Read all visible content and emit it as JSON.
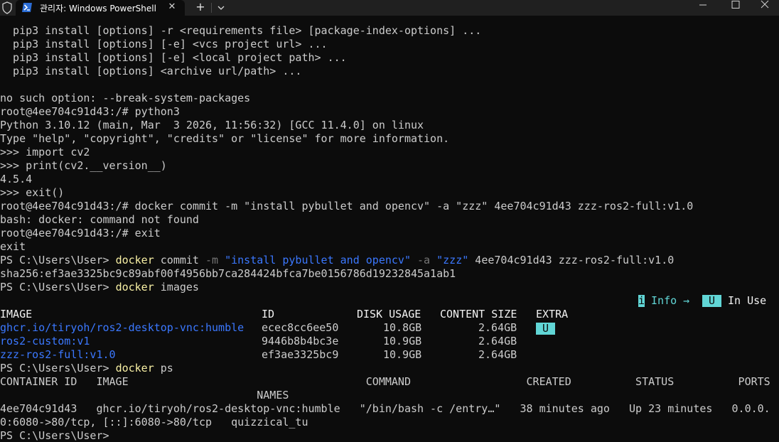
{
  "window": {
    "tab_title": "관리자: Windows PowerShell",
    "tab_close": "✕",
    "new_tab": "+"
  },
  "colors": {
    "background": "#0c0c0c",
    "titlebar": "#202020",
    "text": "#cccccc",
    "command_yellow": "#f9f1a5",
    "link_blue": "#3b78ff",
    "badge_cyan": "#61d6d6"
  },
  "icons": {
    "shield": "shield-icon",
    "powershell": "powershell-icon",
    "dropdown": "chevron-down-icon",
    "minimize": "minimize-icon",
    "maximize": "maximize-icon",
    "close": "close-icon"
  },
  "terminal": {
    "lines": [
      "  pip3 install [options] -r <requirements file> [package-index-options] ...",
      "  pip3 install [options] [-e] <vcs project url> ...",
      "  pip3 install [options] [-e] <local project path> ...",
      "  pip3 install [options] <archive url/path> ...",
      "",
      "no such option: --break-system-packages",
      "root@4ee704c91d43:/# python3",
      "Python 3.10.12 (main, Mar  3 2026, 11:56:32) [GCC 11.4.0] on linux",
      "Type \"help\", \"copyright\", \"credits\" or \"license\" for more information.",
      ">>> import cv2",
      ">>> print(cv2.__version__)",
      "4.5.4",
      ">>> exit()",
      "root@4ee704c91d43:/# docker commit -m \"install pybullet and opencv\" -a \"zzz\" 4ee704c91d43 zzz-ros2-full:v1.0",
      "bash: docker: command not found",
      "root@4ee704c91d43:/# exit",
      "exit"
    ],
    "ps_commit": {
      "prompt": "PS C:\\Users\\User> ",
      "cmd": "docker",
      "sub": " commit ",
      "flag_m": "-m",
      "msg": " \"install pybullet and opencv\"",
      "flag_a": " -a",
      "author": " \"zzz\"",
      "rest": " 4ee704c91d43 zzz-ros2-full:v1.0"
    },
    "sha_line": "sha256:ef3ae3325bc9c89abf00f4956bb7ca284424bfca7be0156786d19232845a1ab1",
    "ps_images": {
      "prompt": "PS C:\\Users\\User> ",
      "cmd": "docker",
      "rest": " images"
    },
    "legend": {
      "info_icon": "i",
      "info_label": " Info →",
      "in_use_badge": "U",
      "in_use_label": " In Use"
    },
    "images_table": {
      "headers": [
        "IMAGE",
        "ID",
        "DISK USAGE",
        "CONTENT SIZE",
        "EXTRA"
      ],
      "rows": [
        {
          "image": "ghcr.io/tiryoh/ros2-desktop-vnc:humble",
          "id": "ecec8cc6ee50",
          "disk": "10.8GB",
          "content": "2.64GB",
          "extra": "U"
        },
        {
          "image": "ros2-custom:v1",
          "id": "9446b8b4bc3e",
          "disk": "10.9GB",
          "content": "2.64GB",
          "extra": ""
        },
        {
          "image": "zzz-ros2-full:v1.0",
          "id": "ef3ae3325bc9",
          "disk": "10.9GB",
          "content": "2.64GB",
          "extra": ""
        }
      ]
    },
    "ps_ps": {
      "prompt": "PS C:\\Users\\User> ",
      "cmd": "docker",
      "rest": " ps"
    },
    "ps_table": {
      "header_line": "CONTAINER ID   IMAGE                                     COMMAND                  CREATED          STATUS          PORTS",
      "header_line2": "                                        NAMES",
      "row_line": "4ee704c91d43   ghcr.io/tiryoh/ros2-desktop-vnc:humble   \"/bin/bash -c /entry…\"   38 minutes ago   Up 23 minutes   0.0.0.",
      "row_line2": "0:6080->80/tcp, [::]:6080->80/tcp   quizzical_tu"
    },
    "final_prompt": "PS C:\\Users\\User> "
  }
}
